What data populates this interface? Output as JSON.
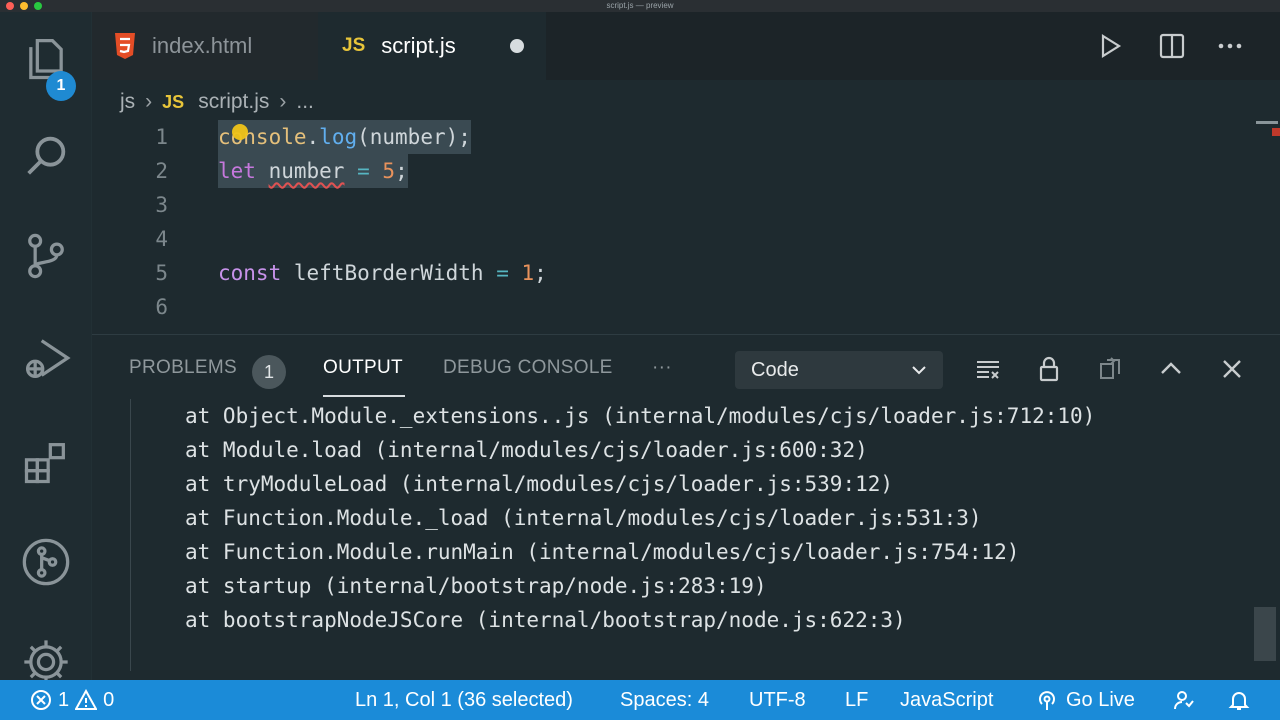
{
  "window": {
    "title": "script.js — preview"
  },
  "activity_bar": {
    "explorer_badge": "1",
    "icons": [
      "files-icon",
      "search-icon",
      "source-control-icon",
      "run-debug-icon",
      "extensions-icon",
      "git-graph-icon",
      "settings-gear-icon"
    ]
  },
  "tabs": [
    {
      "label": "index.html",
      "icon": "html5-icon",
      "active": false
    },
    {
      "label": "script.js",
      "icon_text": "JS",
      "active": true,
      "dirty": true
    }
  ],
  "breadcrumb": {
    "folder": "js",
    "file_icon_text": "JS",
    "file": "script.js",
    "more": "..."
  },
  "editor": {
    "lines": [
      {
        "n": "1",
        "tokens": [
          "console",
          ".",
          "log",
          "(number);"
        ]
      },
      {
        "n": "2",
        "tokens": [
          "let",
          "number",
          "=",
          "5",
          ";"
        ]
      },
      {
        "n": "3",
        "tokens": []
      },
      {
        "n": "4",
        "tokens": []
      },
      {
        "n": "5",
        "tokens": [
          "const",
          "leftBorderWidth",
          "=",
          "1",
          ";"
        ]
      },
      {
        "n": "6",
        "tokens": []
      }
    ]
  },
  "panel": {
    "tabs": {
      "problems": "PROBLEMS",
      "output": "OUTPUT",
      "debug_console": "DEBUG CONSOLE",
      "more": "···"
    },
    "problems_count": "1",
    "output_channel": "Code",
    "output_lines": [
      "at Object.Module._extensions..js (internal/modules/cjs/loader.js:712:10)",
      "at Module.load (internal/modules/cjs/loader.js:600:32)",
      "at tryModuleLoad (internal/modules/cjs/loader.js:539:12)",
      "at Function.Module._load (internal/modules/cjs/loader.js:531:3)",
      "at Function.Module.runMain (internal/modules/cjs/loader.js:754:12)",
      "at startup (internal/bootstrap/node.js:283:19)",
      "at bootstrapNodeJSCore (internal/bootstrap/node.js:622:3)"
    ]
  },
  "status_bar": {
    "errors": "1",
    "warnings": "0",
    "cursor": "Ln 1, Col 1 (36 selected)",
    "spaces": "Spaces: 4",
    "encoding": "UTF-8",
    "eol": "LF",
    "language": "JavaScript",
    "go_live": "Go Live"
  },
  "colors": {
    "status_bar": "#1b8bd8",
    "accent_js": "#e8c53a",
    "html5": "#e44d26"
  }
}
